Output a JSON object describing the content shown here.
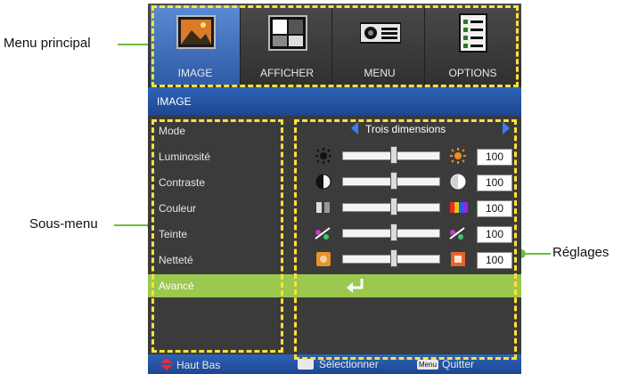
{
  "callouts": {
    "main_menu": "Menu principal",
    "submenu": "Sous-menu",
    "settings": "Réglages"
  },
  "tabs": [
    {
      "label": "IMAGE",
      "icon": "image-icon",
      "active": true
    },
    {
      "label": "AFFICHER",
      "icon": "display-icon",
      "active": false
    },
    {
      "label": "MENU",
      "icon": "projector-icon",
      "active": false
    },
    {
      "label": "OPTIONS",
      "icon": "options-icon",
      "active": false
    }
  ],
  "section_title": "IMAGE",
  "mode": {
    "label": "Mode",
    "value": "Trois dimensions"
  },
  "rows": [
    {
      "label": "Luminosité",
      "value": "100",
      "left_icon": "sun-dim-icon",
      "right_icon": "sun-bright-icon"
    },
    {
      "label": "Contraste",
      "value": "100",
      "left_icon": "contrast-dark-icon",
      "right_icon": "contrast-light-icon"
    },
    {
      "label": "Couleur",
      "value": "100",
      "left_icon": "color-low-icon",
      "right_icon": "color-high-icon"
    },
    {
      "label": "Teinte",
      "value": "100",
      "left_icon": "tint-low-icon",
      "right_icon": "tint-high-icon"
    },
    {
      "label": "Netteté",
      "value": "100",
      "left_icon": "sharp-low-icon",
      "right_icon": "sharp-high-icon"
    }
  ],
  "advanced": {
    "label": "Avancé",
    "icon": "enter-icon"
  },
  "footer": {
    "nav": "Haut Bas",
    "select": "Sélectionner",
    "menu_key": "Menu",
    "quit": "Quitter"
  },
  "colors": {
    "highlight": "#9bc84e",
    "accent_blue": "#2d63b7",
    "dash": "#ffe23a",
    "callout": "#6ebf3c"
  }
}
